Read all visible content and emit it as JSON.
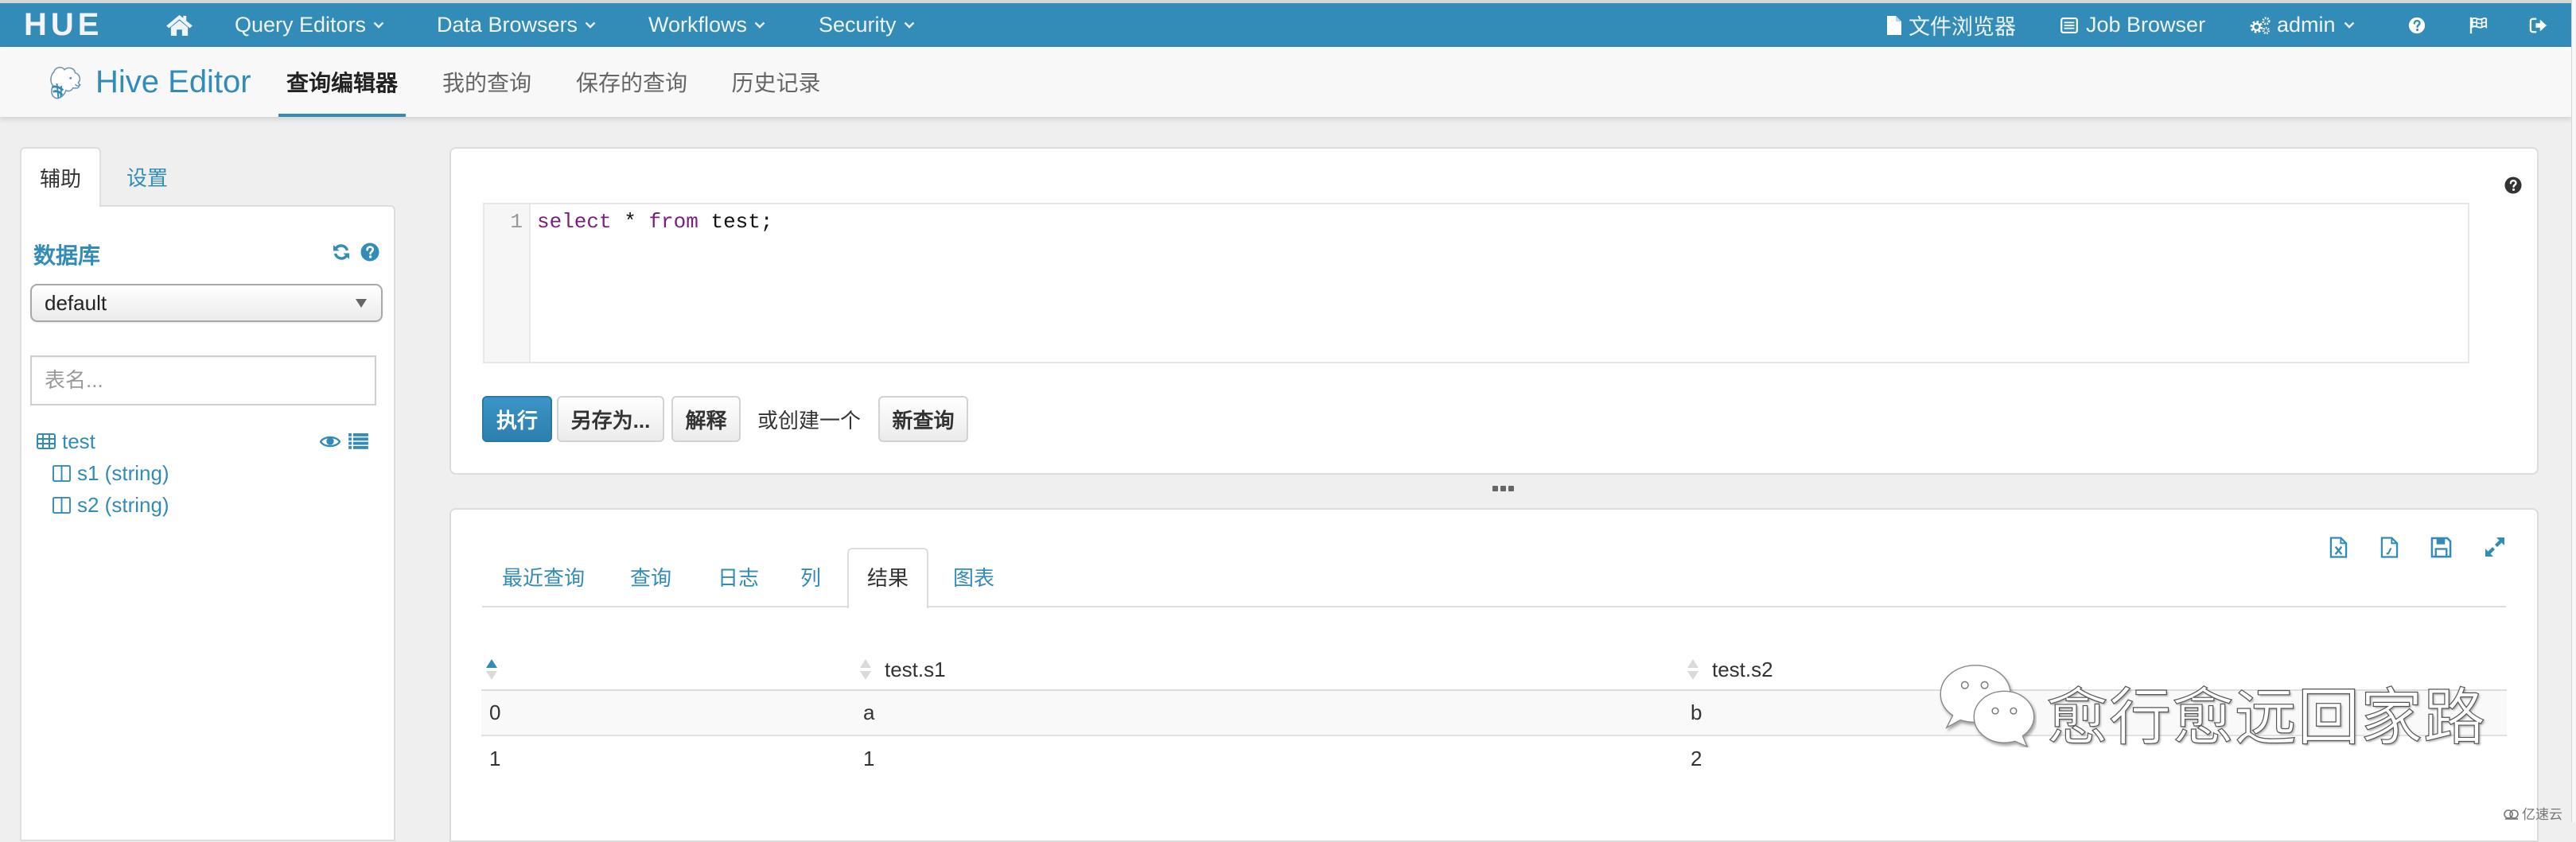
{
  "app": {
    "logo_text": "HUE"
  },
  "navbar": {
    "menus": [
      {
        "label": "Query Editors"
      },
      {
        "label": "Data Browsers"
      },
      {
        "label": "Workflows"
      },
      {
        "label": "Security"
      }
    ],
    "file_browser": "文件浏览器",
    "job_browser": "Job Browser",
    "user": "admin"
  },
  "subnav": {
    "app_title": "Hive Editor",
    "tabs": [
      {
        "label": "查询编辑器",
        "active": true
      },
      {
        "label": "我的查询"
      },
      {
        "label": "保存的查询"
      },
      {
        "label": "历史记录"
      }
    ]
  },
  "sidebar": {
    "tabs": [
      {
        "label": "辅助",
        "active": true
      },
      {
        "label": "设置"
      }
    ],
    "section_title": "数据库",
    "database_select": {
      "value": "default"
    },
    "table_filter": {
      "placeholder": "表名...",
      "value": ""
    },
    "tables": [
      {
        "name": "test",
        "columns": [
          {
            "label": "s1 (string)"
          },
          {
            "label": "s2 (string)"
          }
        ]
      }
    ]
  },
  "editor": {
    "line_numbers": [
      "1"
    ],
    "code_tokens": [
      {
        "text": "select",
        "type": "keyword"
      },
      {
        "text": " * ",
        "type": "operator"
      },
      {
        "text": "from",
        "type": "keyword"
      },
      {
        "text": " test;",
        "type": "identifier"
      }
    ],
    "actions": {
      "execute": "执行",
      "save_as": "另存为...",
      "explain": "解释",
      "or_create_text": "或创建一个",
      "new_query": "新查询"
    }
  },
  "results": {
    "tabs": [
      {
        "label": "最近查询"
      },
      {
        "label": "查询"
      },
      {
        "label": "日志"
      },
      {
        "label": "列"
      },
      {
        "label": "结果",
        "active": true
      },
      {
        "label": "图表"
      }
    ],
    "table": {
      "columns": [
        {
          "label": "",
          "sort": "ascending"
        },
        {
          "label": "test.s1",
          "sort": "none"
        },
        {
          "label": "test.s2",
          "sort": "none"
        }
      ],
      "rows": [
        [
          "0",
          "a",
          "b"
        ],
        [
          "1",
          "1",
          "2"
        ]
      ]
    }
  },
  "watermark": {
    "text": "愈行愈远回家路",
    "site_brand": "亿速云"
  },
  "colors": {
    "brand": "#338bb8",
    "keyword": "#7a1f7e",
    "page_bg": "#efefef",
    "panel_border": "#dddddd",
    "active_sort": "#338bb8"
  }
}
